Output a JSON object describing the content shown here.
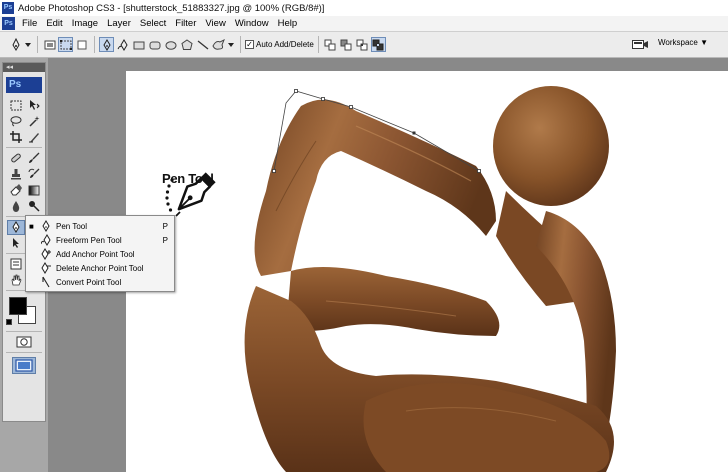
{
  "window": {
    "app_logo": "Ps",
    "title": "Adobe Photoshop CS3 - [shutterstock_51883327.jpg @ 100% (RGB/8#)]"
  },
  "menubar": {
    "logo": "Ps",
    "items": [
      "File",
      "Edit",
      "Image",
      "Layer",
      "Select",
      "Filter",
      "View",
      "Window",
      "Help"
    ]
  },
  "options": {
    "auto_add_delete_label": "Auto Add/Delete",
    "auto_add_delete_checked": true,
    "workspace_label": "Workspace ▼"
  },
  "toolbox": {
    "logo": "Ps",
    "collapse_glyph": "◂◂"
  },
  "flyout": {
    "items": [
      {
        "label": "Pen Tool",
        "shortcut": "P",
        "selected": true,
        "icon": "pen-icon"
      },
      {
        "label": "Freeform Pen Tool",
        "shortcut": "P",
        "selected": false,
        "icon": "freeform-pen-icon"
      },
      {
        "label": "Add Anchor Point Tool",
        "shortcut": "",
        "selected": false,
        "icon": "add-anchor-point-icon"
      },
      {
        "label": "Delete Anchor Point Tool",
        "shortcut": "",
        "selected": false,
        "icon": "delete-anchor-point-icon"
      },
      {
        "label": "Convert Point Tool",
        "shortcut": "",
        "selected": false,
        "icon": "convert-point-icon"
      }
    ]
  },
  "annotation": {
    "label": "Pen Tool",
    "icon": "fountain-pen-icon"
  },
  "colors": {
    "foreground": "#000000",
    "background": "#ffffff",
    "wood": "#8a5530",
    "ps_blue": "#1c3f94"
  }
}
